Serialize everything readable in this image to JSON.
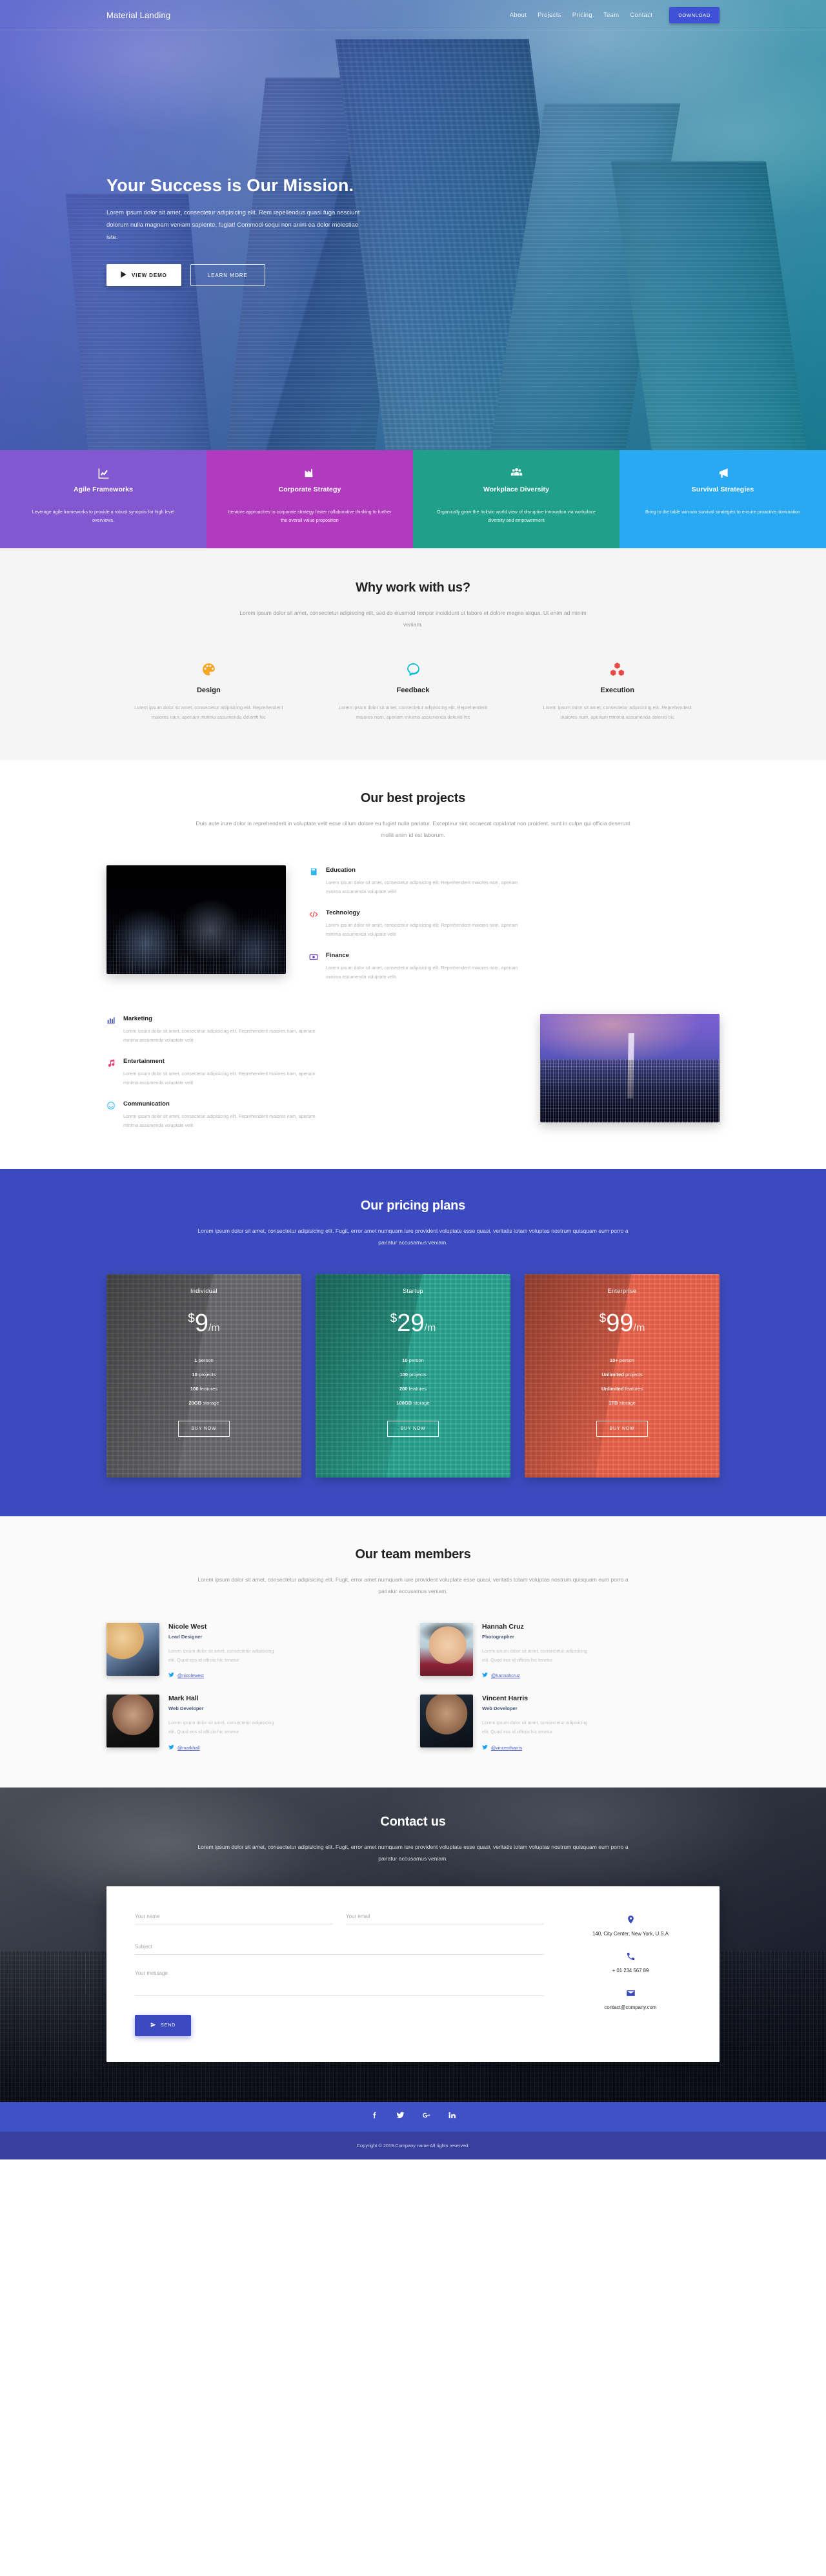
{
  "nav": {
    "brand": "Material Landing",
    "links": [
      {
        "label": "About"
      },
      {
        "label": "Projects"
      },
      {
        "label": "Pricing"
      },
      {
        "label": "Team"
      },
      {
        "label": "Contact"
      }
    ],
    "download_label": "DOWNLOAD"
  },
  "hero": {
    "title": "Your Success is Our Mission.",
    "paragraph": "Lorem ipsum dolor sit amet, consectetur adipisicing elit. Rem repellendus quasi fuga nesciunt dolorum nulla magnam veniam sapiente, fugiat! Commodi sequi non anim ea dolor molestiae iste.",
    "demo_label": "VIEW DEMO",
    "learn_label": "LEARN MORE"
  },
  "features": [
    {
      "icon": "chart-line-icon",
      "title": "Agile Frameworks",
      "text": "Leverage agile frameworks to provide a robust synopsis for high level overviews.",
      "color": "#8357cf"
    },
    {
      "icon": "factory-icon",
      "title": "Corporate Strategy",
      "text": "Iterative approaches to corporate strategy foster collaborative thinking to further the overall value proposition",
      "color": "#b13bbf"
    },
    {
      "icon": "people-group-icon",
      "title": "Workplace Diversity",
      "text": "Organically grow the holistic world view of disruptive innovation via workplace diversity and empowerment",
      "color": "#20a08a"
    },
    {
      "icon": "megaphone-icon",
      "title": "Survival Strategies",
      "text": "Bring to the table win-win survival strategies to ensure proactive domination",
      "color": "#29a9f2"
    }
  ],
  "why": {
    "title": "Why work with us?",
    "subtitle": "Lorem ipsum dolor sit amet, consectetur adipiscing elit, sed do eiusmod tempor incididunt ut labore et dolore magna aliqua. Ut enim ad minim veniam.",
    "columns": [
      {
        "icon": "palette-icon",
        "title": "Design",
        "text": "Lorem ipsum dolor sit amet, consectetur adipisicing elit. Reprehenderit maiores nam, aperiam minima assumenda deleniti hic",
        "color": "#f5a623"
      },
      {
        "icon": "speech-bubble-icon",
        "title": "Feedback",
        "text": "Lorem ipsum dolor sit amet, consectetur adipisicing elit. Reprehenderit maiores nam, aperiam minima assumenda deleniti hic",
        "color": "#00bcd4"
      },
      {
        "icon": "cubes-icon",
        "title": "Execution",
        "text": "Lorem ipsum dolor sit amet, consectetur adipisicing elit. Reprehenderit maiores nam, aperiam minima assumenda deleniti hic",
        "color": "#e94b4b"
      }
    ]
  },
  "projects": {
    "title": "Our best projects",
    "subtitle": "Duis aute irure dolor in reprehenderit in voluptate velit esse cillum dolore eu fugiat nulla pariatur. Excepteur sint occaecat cupidatat non proident, sunt in culpa qui officia deserunt mollit anim id est laborum.",
    "row1": [
      {
        "icon": "book-icon",
        "title": "Education",
        "text": "Lorem ipsum dolor sit amet, consectetur adipisicing elit. Reprehenderit maiores nam, aperiam minima assumenda voluptate velit",
        "color": "#29b6f6"
      },
      {
        "icon": "code-icon",
        "title": "Technology",
        "text": "Lorem ipsum dolor sit amet, consectetur adipisicing elit. Reprehenderit maiores nam, aperiam minima assumenda voluptate velit",
        "color": "#ef5350"
      },
      {
        "icon": "money-icon",
        "title": "Finance",
        "text": "Lorem ipsum dolor sit amet, consectetur adipisicing elit. Reprehenderit maiores nam, aperiam minima assumenda voluptate velit",
        "color": "#5e35b1"
      }
    ],
    "row2": [
      {
        "icon": "bar-chart-icon",
        "title": "Marketing",
        "text": "Lorem ipsum dolor sit amet, consectetur adipisicing elit. Reprehenderit maiores nam, aperiam minima assumenda voluptate velit",
        "color": "#3949ab"
      },
      {
        "icon": "music-note-icon",
        "title": "Entertainment",
        "text": "Lorem ipsum dolor sit amet, consectetur adipisicing elit. Reprehenderit maiores nam, aperiam minima assumenda voluptate velit",
        "color": "#ec407a"
      },
      {
        "icon": "smiley-icon",
        "title": "Communication",
        "text": "Lorem ipsum dolor sit amet, consectetur adipisicing elit. Reprehenderit maiores nam, aperiam minima assumenda voluptate velit",
        "color": "#29b6f6"
      }
    ]
  },
  "pricing": {
    "title": "Our pricing plans",
    "subtitle": "Lorem ipsum dolor sit amet, consectetur adipisicing elit. Fugit, error amet numquam iure provident voluptate esse quasi, veritatis totam voluptas nostrum quisquam eum porro a pariatur accusamus veniam.",
    "plans": [
      {
        "name": "Individual",
        "currency": "$",
        "amount": "9",
        "period": "/m",
        "color": "#6f6f72",
        "features": [
          {
            "bold": "1",
            "rest": " person"
          },
          {
            "bold": "10",
            "rest": " projects"
          },
          {
            "bold": "100",
            "rest": " features"
          },
          {
            "bold": "20GB",
            "rest": " storage"
          }
        ],
        "cta": "BUY NOW"
      },
      {
        "name": "Startup",
        "currency": "$",
        "amount": "29",
        "period": "/m",
        "color": "#2cab96",
        "features": [
          {
            "bold": "10",
            "rest": " person"
          },
          {
            "bold": "100",
            "rest": " projects"
          },
          {
            "bold": "200",
            "rest": " features"
          },
          {
            "bold": "100GB",
            "rest": " storage"
          }
        ],
        "cta": "BUY NOW"
      },
      {
        "name": "Enterprise",
        "currency": "$",
        "amount": "99",
        "period": "/m",
        "color": "#f4684f",
        "features": [
          {
            "bold": "10+",
            "rest": " person"
          },
          {
            "bold": "Unlimited",
            "rest": " projects"
          },
          {
            "bold": "Unlimited",
            "rest": " features"
          },
          {
            "bold": "1TB",
            "rest": " storage"
          }
        ],
        "cta": "BUY NOW"
      }
    ]
  },
  "team": {
    "title": "Our team members",
    "subtitle": "Lorem ipsum dolor sit amet, consectetur adipisicing elit. Fugit, error amet numquam iure provident voluptate esse quasi, veritatis totam voluptas nostrum quisquam eum porro a pariatur accusamus veniam.",
    "members": [
      {
        "name": "Nicole West",
        "role": "Lead Designer",
        "bio": "Lorem ipsum dolor sit amet, consectetur adipisicing elit. Quod eos id officiis hic tenetur",
        "handle": "@nicolewest",
        "photo": "ph1"
      },
      {
        "name": "Hannah Cruz",
        "role": "Photographer",
        "bio": "Lorem ipsum dolor sit amet, consectetur adipisicing elit. Quod eos id officiis hic tenetur",
        "handle": "@hannahcruz",
        "photo": "ph2"
      },
      {
        "name": "Mark Hall",
        "role": "Web Developer",
        "bio": "Lorem ipsum dolor sit amet, consectetur adipisicing elit. Quod eos id officiis hic tenetur",
        "handle": "@markhall",
        "photo": "ph3"
      },
      {
        "name": "Vincent Harris",
        "role": "Web Developer",
        "bio": "Lorem ipsum dolor sit amet, consectetur adipisicing elit. Quod eos id officiis hic tenetur",
        "handle": "@vincentharris",
        "photo": "ph4"
      }
    ]
  },
  "contact": {
    "title": "Contact us",
    "subtitle": "Lorem ipsum dolor sit amet, consectetur adipisicing elit. Fugit, error amet numquam iure provident voluptate esse quasi, veritatis totam voluptas nostrum quisquam eum porro a pariatur accusamus veniam.",
    "form": {
      "name_placeholder": "Your name",
      "name_value": "",
      "email_placeholder": "Your email",
      "email_value": "",
      "subject_placeholder": "Subject",
      "subject_value": "",
      "message_placeholder": "Your message",
      "message_value": "",
      "send_label": "SEND"
    },
    "info": {
      "address": "140, City Center, New York, U.S.A",
      "phone": "+ 01 234 567 89",
      "email": "contact@company.com"
    }
  },
  "footer": {
    "social": [
      {
        "name": "facebook-icon",
        "glyph": "f"
      },
      {
        "name": "twitter-icon",
        "glyph": "t"
      },
      {
        "name": "google-plus-icon",
        "glyph": "g"
      },
      {
        "name": "linkedin-icon",
        "glyph": "in"
      }
    ],
    "copyright": "Copyright © 2019.Company name All rights reserved."
  }
}
